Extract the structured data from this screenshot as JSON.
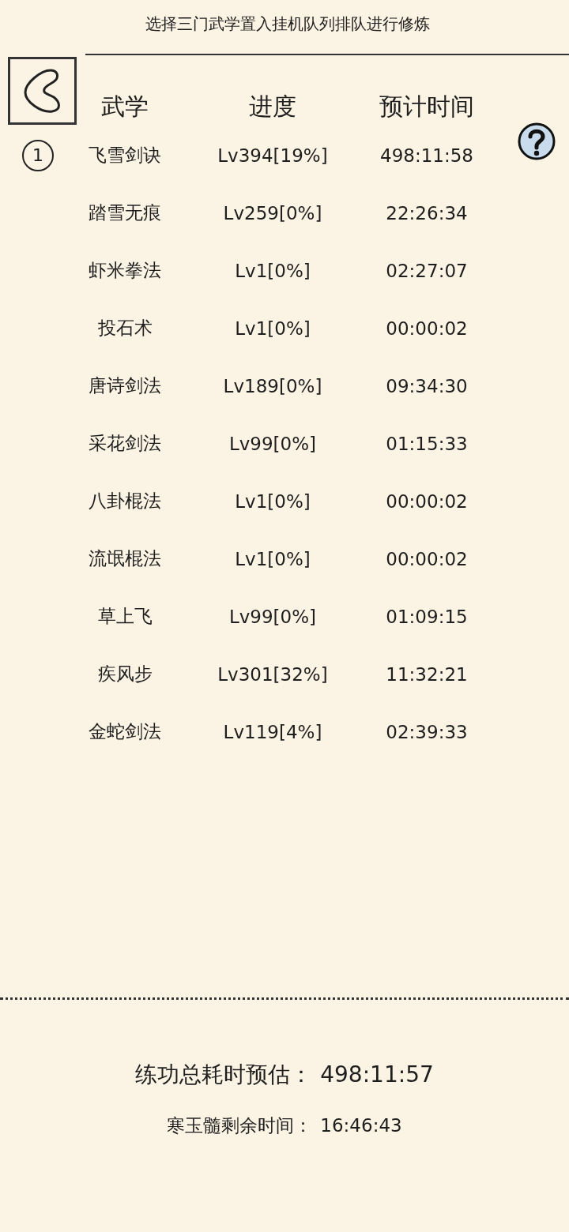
{
  "title": "选择三门武学置入挂机队列排队进行修炼",
  "columns": [
    "武学",
    "进度",
    "预计时间"
  ],
  "rows": [
    {
      "queue": "1",
      "name": "飞雪剑诀",
      "progress": "Lv394[19%]",
      "time": "498:11:58"
    },
    {
      "name": "踏雪无痕",
      "progress": "Lv259[0%]",
      "time": "22:26:34"
    },
    {
      "name": "虾米拳法",
      "progress": "Lv1[0%]",
      "time": "02:27:07"
    },
    {
      "name": "投石术",
      "progress": "Lv1[0%]",
      "time": "00:00:02"
    },
    {
      "name": "唐诗剑法",
      "progress": "Lv189[0%]",
      "time": "09:34:30"
    },
    {
      "name": "采花剑法",
      "progress": "Lv99[0%]",
      "time": "01:15:33"
    },
    {
      "name": "八卦棍法",
      "progress": "Lv1[0%]",
      "time": "00:00:02"
    },
    {
      "name": "流氓棍法",
      "progress": "Lv1[0%]",
      "time": "00:00:02"
    },
    {
      "name": "草上飞",
      "progress": "Lv99[0%]",
      "time": "01:09:15"
    },
    {
      "name": "疾风步",
      "progress": "Lv301[32%]",
      "time": "11:32:21"
    },
    {
      "name": "金蛇剑法",
      "progress": "Lv119[4%]",
      "time": "02:39:33"
    }
  ],
  "total": {
    "label": "练功总耗时预估：",
    "value": "498:11:57"
  },
  "remaining": {
    "label": "寒玉髓剩余时间：",
    "value": "16:46:43"
  }
}
